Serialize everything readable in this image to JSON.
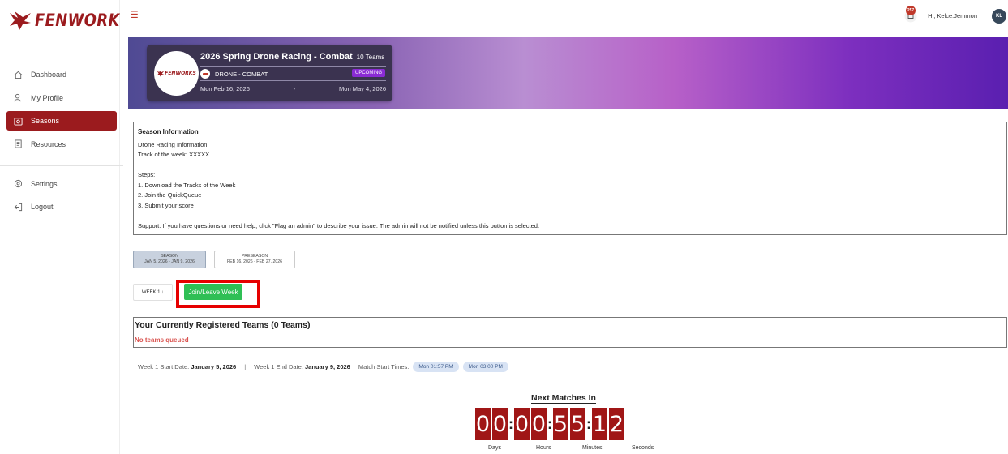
{
  "brand": {
    "name": "FENWORKS"
  },
  "nav": {
    "items": [
      {
        "label": "Dashboard",
        "icon": "home-icon",
        "active": false
      },
      {
        "label": "My Profile",
        "icon": "user-icon",
        "active": false
      },
      {
        "label": "Seasons",
        "icon": "calendar-icon",
        "active": true
      },
      {
        "label": "Resources",
        "icon": "document-icon",
        "active": false
      }
    ],
    "secondary": [
      {
        "label": "Settings",
        "icon": "gear-icon"
      },
      {
        "label": "Logout",
        "icon": "logout-icon"
      }
    ]
  },
  "topbar": {
    "notification_count": "257",
    "greeting": "Hi, Kelce.Jemmon",
    "avatar_initials": "KL"
  },
  "season": {
    "title": "2026 Spring Drone Racing - Combat",
    "teams": "10 Teams",
    "category": "DRONE - COMBAT",
    "status": "UPCOMING",
    "start_date": "Mon Feb 16, 2026",
    "date_sep": "-",
    "end_date": "Mon May 4, 2026",
    "logo_text": "FENWORKS"
  },
  "info": {
    "title": "Season Information",
    "line1": "Drone Racing Information",
    "line2": "Track of the week: XXXXX",
    "steps_label": "Steps:",
    "step1": "1. Download the Tracks of the Week",
    "step2": "2. Join the QuickQueue",
    "step3": "3. Submit your score",
    "support": "Support: If you have questions or need help, click \"Flag an admin\" to describe your issue. The admin will not be notified unless this button is selected."
  },
  "phase_tabs": [
    {
      "name": "SEASON",
      "range": "JAN 5, 2026 - JAN 9, 2026",
      "active": true
    },
    {
      "name": "PRESEASON",
      "range": "FEB 16, 2026 - FEB 27, 2026",
      "active": false
    }
  ],
  "week": {
    "selector": "WEEK 1 ↓",
    "join_label": "Join/Leave Week"
  },
  "teams": {
    "title": "Your Currently Registered Teams (0 Teams)",
    "empty": "No teams queued"
  },
  "schedule": {
    "start_label": "Week 1 Start Date:",
    "start_value": "January 5, 2026",
    "sep": "|",
    "end_label": "Week 1 End Date:",
    "end_value": "January 9, 2026",
    "times_label": "Match Start Times:",
    "times": [
      "Mon 01:57 PM",
      "Mon 03:00 PM"
    ]
  },
  "countdown": {
    "title": "Next Matches In",
    "digits": [
      "0",
      "0",
      "0",
      "0",
      "5",
      "5",
      "1",
      "2"
    ],
    "labels": [
      "Days",
      "Hours",
      "Minutes",
      "Seconds"
    ]
  },
  "colors": {
    "brand_red": "#9b1b1e",
    "join_green": "#2fbf55",
    "highlight": "#e60000",
    "upcoming_purple": "#8a2bd4"
  }
}
